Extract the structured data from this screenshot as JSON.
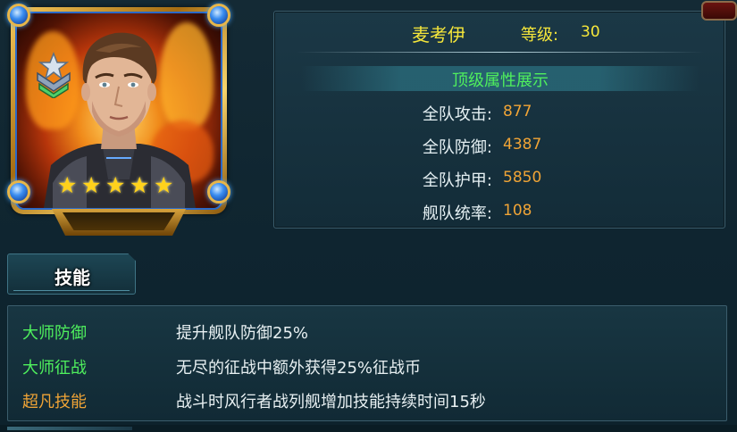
{
  "hero": {
    "name": "麦考伊",
    "level_label": "等级:",
    "level_value": "30",
    "star_count": 5,
    "star_glyph": "★",
    "rank_icon": "chevron-star-rank-icon"
  },
  "attributes": {
    "title": "顶级属性展示",
    "items": [
      {
        "label": "全队攻击:",
        "value": "877"
      },
      {
        "label": "全队防御:",
        "value": "4387"
      },
      {
        "label": "全队护甲:",
        "value": "5850"
      },
      {
        "label": "舰队统率:",
        "value": "108"
      }
    ]
  },
  "skills": {
    "tab_label": "技能",
    "items": [
      {
        "name": "大师防御",
        "desc": "提升舰队防御25%",
        "name_color": "#4ff05d"
      },
      {
        "name": "大师征战",
        "desc": "无尽的征战中额外获得25%征战币",
        "name_color": "#4ff05d"
      },
      {
        "name": "超凡技能",
        "desc": "战斗时风行者战列舰增加技能持续时间15秒",
        "name_color": "#f0a436"
      }
    ]
  },
  "colors": {
    "name_yellow": "#f6e73a",
    "value_orange": "#f0a436",
    "title_green": "#4ff05d",
    "panel_bg": "#183642"
  }
}
